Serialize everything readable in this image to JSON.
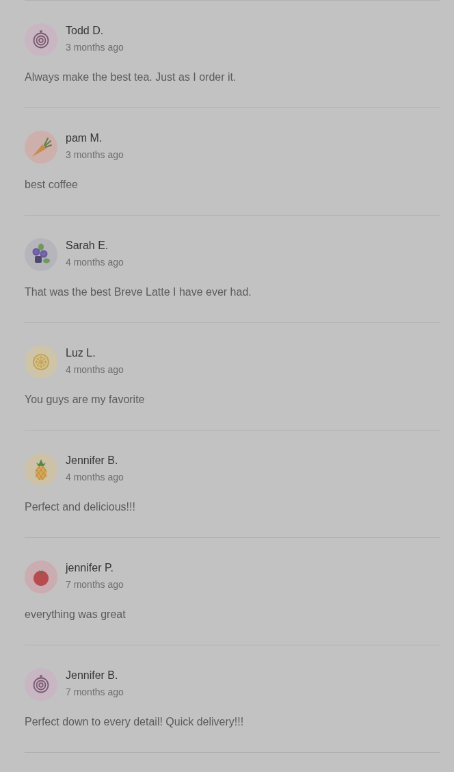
{
  "reviews": [
    {
      "avatar": {
        "kind": "onion"
      },
      "author": "Todd D.",
      "time": "3 months ago",
      "comment": "Always make the best tea. Just as I order it."
    },
    {
      "avatar": {
        "kind": "carrot"
      },
      "author": "pam M.",
      "time": "3 months ago",
      "comment": "best coffee"
    },
    {
      "avatar": {
        "kind": "berries"
      },
      "author": "Sarah E.",
      "time": "4 months ago",
      "comment": "That was the best Breve Latte I have ever had."
    },
    {
      "avatar": {
        "kind": "lemon"
      },
      "author": "Luz L.",
      "time": "4 months ago",
      "comment": "You guys are my favorite"
    },
    {
      "avatar": {
        "kind": "pineapple"
      },
      "author": "Jennifer B.",
      "time": "4 months ago",
      "comment": "Perfect and delicious!!!"
    },
    {
      "avatar": {
        "kind": "tomato"
      },
      "author": "jennifer P.",
      "time": "7 months ago",
      "comment": "everything was great"
    },
    {
      "avatar": {
        "kind": "onion"
      },
      "author": "Jennifer B.",
      "time": "7 months ago",
      "comment": "Perfect down to every detail! Quick delivery!!!"
    }
  ]
}
